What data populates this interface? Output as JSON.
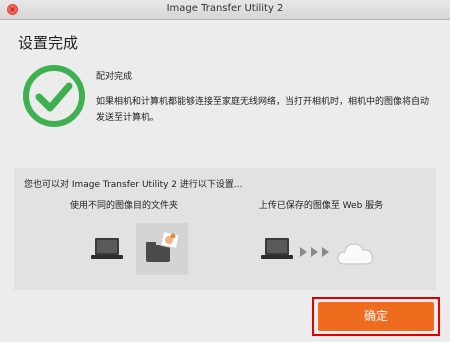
{
  "window": {
    "title": "Image Transfer Utility 2",
    "close_glyph": "×"
  },
  "heading": "设置完成",
  "status": {
    "icon": "check-circle-icon",
    "pair_label": "配对完成",
    "description": "如果相机和计算机都能够连接至家庭无线网络，当打开相机时，相机中的图像将自动发送至计算机。"
  },
  "panel": {
    "title": "您也可以对 Image Transfer Utility 2 进行以下设置...",
    "option1_caption": "使用不同的图像目的文件夹",
    "option2_caption": "上传已保存的图像至 Web 服务"
  },
  "confirm_label": "确定",
  "colors": {
    "accent": "#ef6c1f",
    "check": "#3fb04f",
    "highlight": "#e00000"
  }
}
